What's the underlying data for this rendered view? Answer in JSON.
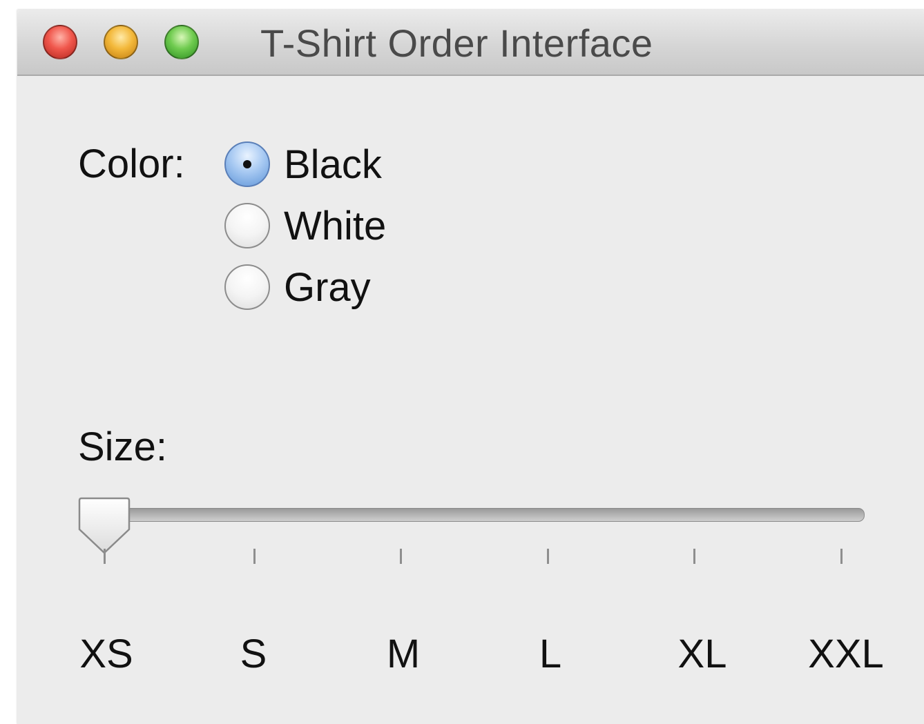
{
  "window": {
    "title": "T-Shirt Order Interface"
  },
  "color": {
    "label": "Color:",
    "options": [
      "Black",
      "White",
      "Gray"
    ],
    "selected": "Black"
  },
  "size": {
    "label": "Size:",
    "ticks": [
      "XS",
      "S",
      "M",
      "L",
      "XL",
      "XXL"
    ],
    "selected": "XS"
  }
}
